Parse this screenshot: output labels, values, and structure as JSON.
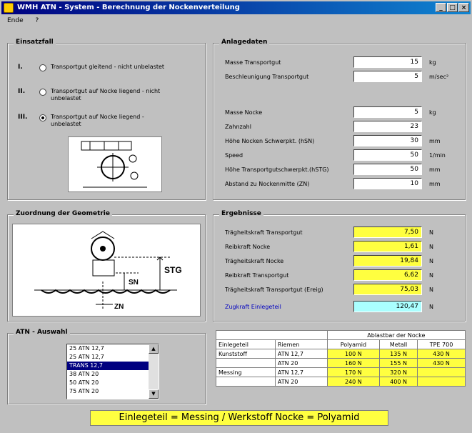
{
  "window": {
    "title": "WMH ATN - System - Berechnung der Nockenverteilung",
    "btn_min": "_",
    "btn_max": "□",
    "btn_close": "×"
  },
  "menu": {
    "items": [
      "Ende",
      "?"
    ]
  },
  "einsatzfall": {
    "title": "Einsatzfall",
    "options": [
      {
        "roman": "I.",
        "label": "Transportgut gleitend - nicht unbelastet",
        "checked": false
      },
      {
        "roman": "II.",
        "label": "Transportgut auf Nocke liegend - nicht unbelastet",
        "checked": false
      },
      {
        "roman": "III.",
        "label": "Transportgut auf Nocke liegend - unbelastet",
        "checked": true
      }
    ]
  },
  "anlagedaten": {
    "title": "Anlagedaten",
    "fields": [
      {
        "label": "Masse Transportgut",
        "value": "15",
        "unit": "kg"
      },
      {
        "label": "Beschleunigung Transportgut",
        "value": "5",
        "unit": "m/sec²"
      },
      {
        "label": "Masse Nocke",
        "value": "5",
        "unit": "kg"
      },
      {
        "label": "Zahnzahl",
        "value": "23",
        "unit": ""
      },
      {
        "label": "Höhe Nocken Schwerpkt. (hSN)",
        "value": "30",
        "unit": "mm"
      },
      {
        "label": "Speed",
        "value": "50",
        "unit": "1/min"
      },
      {
        "label": "Höhe Transportgutschwerpkt.(hSTG)",
        "value": "50",
        "unit": "mm"
      },
      {
        "label": "Abstand zu Nockenmitte (ZN)",
        "value": "10",
        "unit": "mm"
      }
    ]
  },
  "zuordnung": {
    "title": "Zuordnung der Geometrie",
    "label_stg": "STG",
    "label_sn": "SN",
    "label_zn": "ZN"
  },
  "ergebnisse": {
    "title": "Ergebnisse",
    "fields": [
      {
        "label": "Trägheitskraft Transportgut",
        "value": "7,50",
        "unit": "N",
        "style": "yellow"
      },
      {
        "label": "Reibkraft Nocke",
        "value": "1,61",
        "unit": "N",
        "style": "yellow"
      },
      {
        "label": "Trägheitskraft Nocke",
        "value": "19,84",
        "unit": "N",
        "style": "yellow"
      },
      {
        "label": "Reibkraft Transportgut",
        "value": "6,62",
        "unit": "N",
        "style": "yellow"
      },
      {
        "label": "Trägheitskraft Transportgut (Ereig)",
        "value": "75,03",
        "unit": "N",
        "style": "yellow"
      },
      {
        "label": "Zugkraft Einlegeteil",
        "value": "120,47",
        "unit": "N",
        "style": "cyan"
      }
    ]
  },
  "atn": {
    "title": "ATN - Auswahl",
    "items": [
      "25 ATN 12,7",
      "25 ATN 12,7",
      "TRANS 12,7",
      "38 ATN 20",
      "50 ATN 20",
      "75 ATN 20"
    ],
    "selected_index": 2
  },
  "table": {
    "header_group": "Ablastbar der Nocke",
    "headers": [
      "Einlegeteil",
      "Riemen",
      "Polyamid",
      "Metall",
      "TPE 700"
    ],
    "rows": [
      [
        "Kunststoff",
        "ATN 12,7",
        "100 N",
        "135 N",
        "430 N"
      ],
      [
        "",
        "ATN 20",
        "160 N",
        "155 N",
        "430 N"
      ],
      [
        "Messing",
        "ATN 12,7",
        "170 N",
        "320 N",
        ""
      ],
      [
        "",
        "ATN 20",
        "240 N",
        "400 N",
        ""
      ]
    ]
  },
  "status": {
    "text": "Einlegeteil = Messing / Werkstoff Nocke = Polyamid"
  }
}
